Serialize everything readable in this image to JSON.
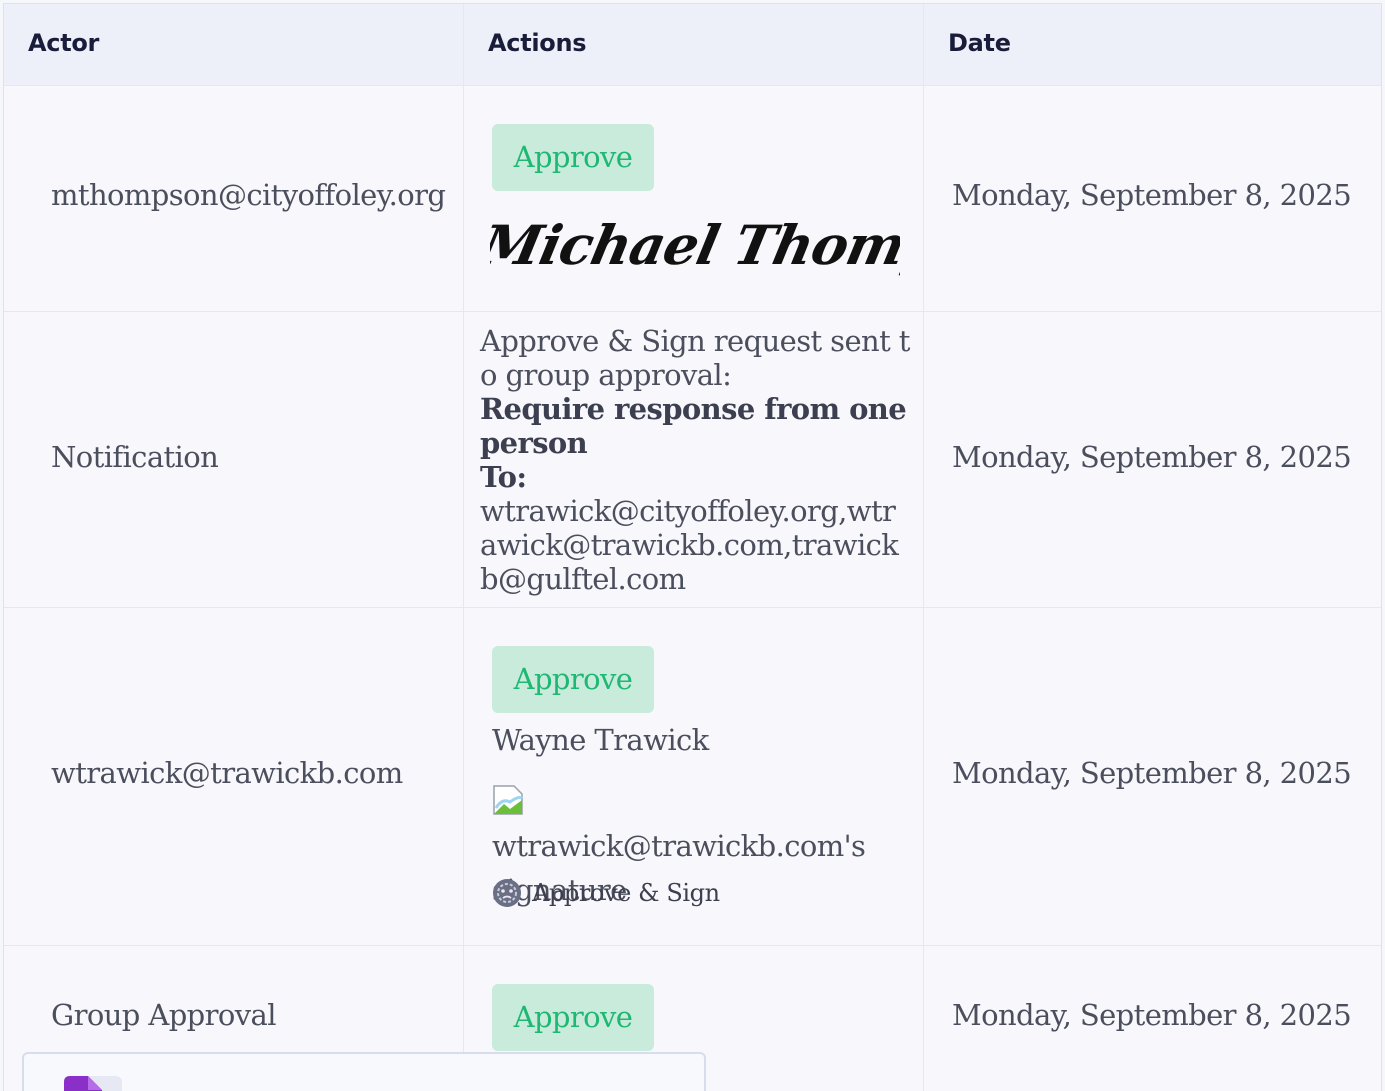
{
  "table": {
    "headers": {
      "actor": "Actor",
      "actions": "Actions",
      "date": "Date"
    },
    "rows": [
      {
        "actor": "mthompson@cityoffoley.org",
        "action_button": "Approve",
        "signature_text": "Michael Thompson",
        "date": "Monday, September 8, 2025"
      },
      {
        "actor": "Notification",
        "message_line": "Approve & Sign request sent to group approval:",
        "requirement": "Require response from one person",
        "to_label": "To:",
        "recipients": "wtrawick@cityoffoley.org,wtrawick@trawickb.com,trawickb@gulftel.com",
        "date": "Monday, September 8, 2025"
      },
      {
        "actor": "wtrawick@trawickb.com",
        "action_button": "Approve",
        "signer_name": "Wayne Trawick",
        "signature_alt": "wtrawick@trawickb.com's signature",
        "action_type": "Approve & Sign",
        "date": "Monday, September 8, 2025"
      },
      {
        "actor": "Group Approval",
        "action_button": "Approve",
        "date": "Monday, September 8, 2025"
      }
    ]
  },
  "icons": {
    "approve_sign_icon": "face-icon",
    "broken_image_icon": "broken-image-icon",
    "document_icon": "document-icon"
  },
  "colors": {
    "approve_bg": "#c8ebdc",
    "approve_text": "#1fb872",
    "header_bg": "#eef0f9",
    "doc_icon": "#8b2fc9"
  }
}
